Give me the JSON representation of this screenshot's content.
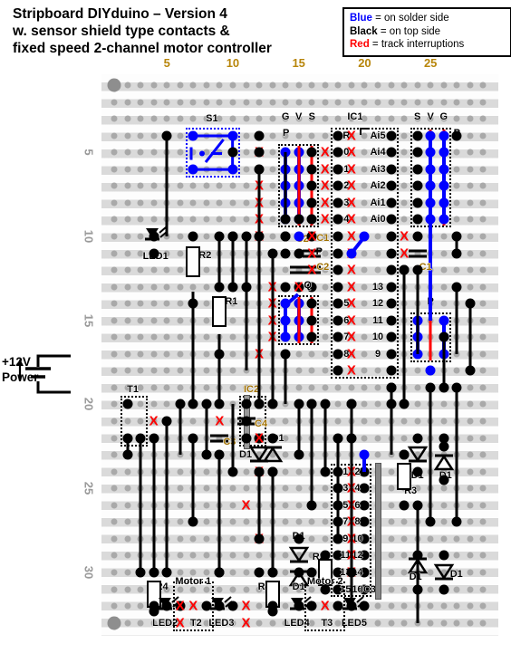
{
  "title": {
    "line1": "Stripboard DIYduino – Version 4",
    "line2": "w. sensor shield type contacts &",
    "line3": "fixed speed 2-channel motor controller"
  },
  "legend": {
    "items": [
      {
        "key": "Blue",
        "text": " = on solder side",
        "color": "#0000ff"
      },
      {
        "key": "Black",
        "text": " = on top side",
        "color": "#000000"
      },
      {
        "key": "Red",
        "text": " = track interruptions",
        "color": "#ff0000"
      }
    ]
  },
  "power": {
    "label_line1": "+12V",
    "label_line2": "Power"
  },
  "rulers": {
    "columns": [
      "5",
      "10",
      "15",
      "20",
      "25"
    ],
    "rows": [
      "5",
      "10",
      "15",
      "20",
      "25",
      "30"
    ]
  },
  "board": {
    "columns": 29,
    "rows": 33
  },
  "components": [
    {
      "name": "S1",
      "label": "S1"
    },
    {
      "name": "IC1",
      "label": "IC1"
    },
    {
      "name": "IC2",
      "label": "IC2"
    },
    {
      "name": "IC3",
      "label": "IC3"
    },
    {
      "name": "LED1",
      "label": "LED1"
    },
    {
      "name": "LED2",
      "label": "LED2"
    },
    {
      "name": "LED3",
      "label": "LED3"
    },
    {
      "name": "LED4",
      "label": "LED4"
    },
    {
      "name": "LED5",
      "label": "LED5"
    },
    {
      "name": "R1",
      "label": "R1"
    },
    {
      "name": "R2",
      "label": "R2"
    },
    {
      "name": "R3a",
      "label": "R3"
    },
    {
      "name": "R3b",
      "label": "R3"
    },
    {
      "name": "R4a",
      "label": "R4"
    },
    {
      "name": "R4b",
      "label": "R4"
    },
    {
      "name": "C1a",
      "label": "C1"
    },
    {
      "name": "C1b",
      "label": "C1"
    },
    {
      "name": "C2a",
      "label": "C2"
    },
    {
      "name": "C2b",
      "label": "C2"
    },
    {
      "name": "C3",
      "label": "C3"
    },
    {
      "name": "C4",
      "label": "C4"
    },
    {
      "name": "Q",
      "label": "Q"
    },
    {
      "name": "T1",
      "label": "T1"
    },
    {
      "name": "T2",
      "label": "T2"
    },
    {
      "name": "T3",
      "label": "T3"
    },
    {
      "name": "Motor1",
      "label": "Motor 1"
    },
    {
      "name": "Motor2",
      "label": "Motor 2"
    },
    {
      "name": "D1_a",
      "label": "D1"
    },
    {
      "name": "D1_b",
      "label": "D1"
    },
    {
      "name": "D1_c",
      "label": "D1"
    },
    {
      "name": "D1_d",
      "label": "D1"
    },
    {
      "name": "D1_e",
      "label": "D1"
    },
    {
      "name": "D1_f",
      "label": "D1"
    },
    {
      "name": "D1_g",
      "label": "D1"
    },
    {
      "name": "D1_h",
      "label": "D1"
    }
  ],
  "ic1": {
    "label": "IC1",
    "left_pins": [
      "R",
      "0",
      "1",
      "2",
      "3",
      "4",
      "5",
      "6",
      "7",
      "8"
    ],
    "right_pins": [
      "Ai5",
      "Ai4",
      "Ai3",
      "Ai2",
      "Ai1",
      "Ai0",
      "13",
      "12",
      "11",
      "10",
      "9"
    ]
  },
  "ic3": {
    "label": "IC3",
    "left_pins": [
      "1",
      "3",
      "5",
      "7",
      "9",
      "11",
      "13",
      "15"
    ],
    "right_pins": [
      "2",
      "4",
      "6",
      "8",
      "10",
      "12",
      "14",
      "16"
    ]
  },
  "headers": {
    "top_sensor": [
      "G",
      "V",
      "S"
    ],
    "right_sensor": [
      "S",
      "V",
      "G"
    ],
    "pin_label": "P"
  },
  "colors": {
    "solder_blue": "#0000ff",
    "top_black": "#000000",
    "interrupt_red": "#ff0000",
    "board": "#f2f2f2",
    "hole": "#a9a9a9",
    "ruler_col": "#b8860b",
    "ruler_row": "#9a9a9a"
  }
}
